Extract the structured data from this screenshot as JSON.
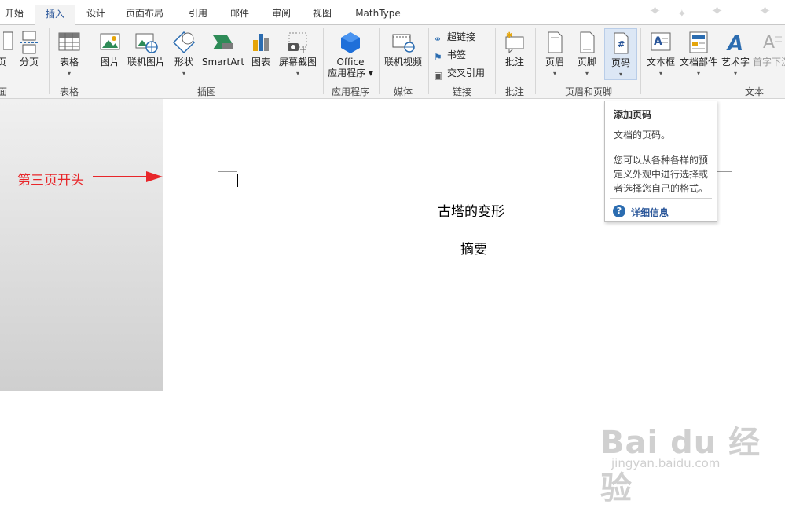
{
  "tabs": [
    {
      "label": "开始",
      "active": false
    },
    {
      "label": "插入",
      "active": true
    },
    {
      "label": "设计",
      "active": false
    },
    {
      "label": "页面布局",
      "active": false
    },
    {
      "label": "引用",
      "active": false
    },
    {
      "label": "邮件",
      "active": false
    },
    {
      "label": "审阅",
      "active": false
    },
    {
      "label": "视图",
      "active": false
    },
    {
      "label": "MathType",
      "active": false
    }
  ],
  "ribbon": {
    "pages": {
      "page_label": "页",
      "page_break_label": "分页",
      "group_label": "面"
    },
    "table": {
      "label": "表格",
      "group_label": "表格"
    },
    "illustrations": {
      "picture_label": "图片",
      "online_picture_label": "联机图片",
      "shapes_label": "形状",
      "smartart_label": "SmartArt",
      "chart_label": "图表",
      "screenshot_label": "屏幕截图",
      "group_label": "插图"
    },
    "apps": {
      "office_label": "Office",
      "office_label2": "应用程序",
      "group_label": "应用程序"
    },
    "media": {
      "online_video_label": "联机视频",
      "group_label": "媒体"
    },
    "links": {
      "hyperlink_label": "超链接",
      "bookmark_label": "书签",
      "cross_ref_label": "交叉引用",
      "group_label": "链接"
    },
    "comments": {
      "comment_label": "批注",
      "group_label": "批注"
    },
    "header_footer": {
      "header_label": "页眉",
      "footer_label": "页脚",
      "page_number_label": "页码",
      "group_label": "页眉和页脚"
    },
    "text": {
      "textbox_label": "文本框",
      "quick_parts_label": "文档部件",
      "wordart_label": "艺术字",
      "dropcap_label": "首字下沉",
      "group_label": "文本"
    }
  },
  "tooltip": {
    "title": "添加页码",
    "line1": "文档的页码。",
    "description": "您可以从各种各样的预定义外观中进行选择或者选择您自己的格式。",
    "more_info": "详细信息"
  },
  "document": {
    "title": "古塔的变形",
    "abstract": "摘要"
  },
  "annotation": {
    "text": "第三页开头",
    "color": "#e8262a"
  },
  "watermark": {
    "logo_text": "Bai du 经验",
    "url": "jingyan.baidu.com"
  },
  "colors": {
    "accent": "#2b579a",
    "ribbon_bg": "#f3f3f3",
    "highlight": "#dce7f5"
  }
}
